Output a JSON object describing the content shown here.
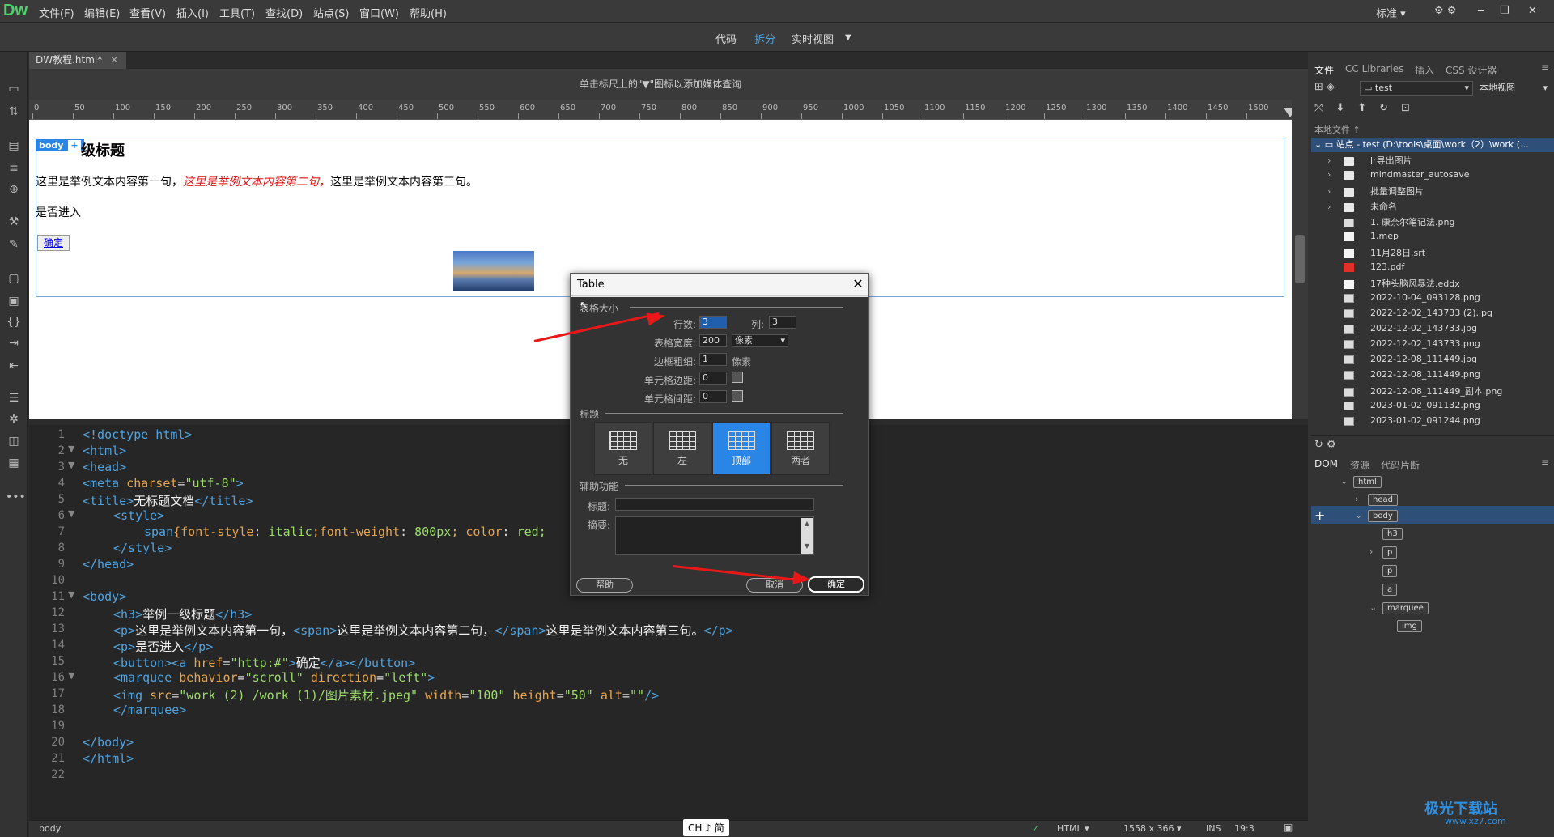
{
  "app": {
    "logo": "Dw",
    "workspace": "标准"
  },
  "menu": [
    "文件(F)",
    "编辑(E)",
    "查看(V)",
    "插入(I)",
    "工具(T)",
    "查找(D)",
    "站点(S)",
    "窗口(W)",
    "帮助(H)"
  ],
  "views": {
    "code": "代码",
    "split": "拆分",
    "live": "实时视图"
  },
  "document": {
    "tab": "DW教程.html*",
    "hint": "单击标尺上的\"▼\"图标以添加媒体查询"
  },
  "ruler": [
    "0",
    "50",
    "100",
    "150",
    "200",
    "250",
    "300",
    "350",
    "400",
    "450",
    "500",
    "550",
    "600",
    "650",
    "700",
    "750",
    "800",
    "850",
    "900",
    "950",
    "1000",
    "1050",
    "1100",
    "1150",
    "1200",
    "1250",
    "1300",
    "1350",
    "1400",
    "1450",
    "1500"
  ],
  "live": {
    "body_tag": "body",
    "plus": "+",
    "h3": "级标题",
    "p1a": "这里是举例文本内容第一句，",
    "p1b": "这里是举例文本内容第二句，",
    "p1c": "这里是举例文本内容第三句。",
    "p2": "是否进入",
    "button": "确定"
  },
  "code": {
    "lines": [
      "1",
      "2",
      "3",
      "4",
      "5",
      "6",
      "7",
      "8",
      "9",
      "10",
      "11",
      "12",
      "13",
      "14",
      "15",
      "16",
      "17",
      "18",
      "19",
      "20",
      "21",
      "22"
    ],
    "l1": "<!doctype html>",
    "l2": "<html>",
    "l3": "<head>",
    "l4a": "<meta ",
    "l4b": "charset",
    "l4c": "=",
    "l4d": "\"utf-8\"",
    "l4e": ">",
    "l5a": "<title>",
    "l5b": "无标题文档",
    "l5c": "</title>",
    "l6": "<style>",
    "l7a": "span",
    "l7b": "{font-style",
    "l7c": ": ",
    "l7d": "italic",
    "l7e": ";font-weight",
    "l7f": ": ",
    "l7g": "800px",
    "l7h": "; color",
    "l7i": ": ",
    "l7j": "red;",
    "l8": "</style>",
    "l9": "</head>",
    "l11": "<body>",
    "l12a": "<h3>",
    "l12b": "举例一级标题",
    "l12c": "</h3>",
    "l13a": "<p>",
    "l13b": "这里是举例文本内容第一句，",
    "l13c": "<span>",
    "l13d": "这里是举例文本内容第二句，",
    "l13e": "</span>",
    "l13f": "这里是举例文本内容第三句。",
    "l13g": "</p>",
    "l14a": "<p>",
    "l14b": "是否进入",
    "l14c": "</p>",
    "l15a": "<button><a ",
    "l15b": "href",
    "l15c": "=",
    "l15d": "\"http:#\"",
    "l15e": ">",
    "l15f": "确定",
    "l15g": "</a></button>",
    "l16a": "<marquee ",
    "l16b": "behavior",
    "l16c": "=",
    "l16d": "\"scroll\"",
    "l16e": " direction",
    "l16f": "=",
    "l16g": "\"left\"",
    "l16h": ">",
    "l17a": "<img ",
    "l17b": "src",
    "l17c": "=",
    "l17d": "\"work (2) /work (1)/图片素材.jpeg\"",
    "l17e": " width",
    "l17f": "=",
    "l17g": "\"100\"",
    "l17h": " height",
    "l17i": "=",
    "l17j": "\"50\"",
    "l17k": " alt",
    "l17l": "=",
    "l17m": "\"\"",
    "l17n": "/>",
    "l18": "</marquee>",
    "l20": "</body>",
    "l21": "</html>"
  },
  "status": {
    "tag": "body",
    "ime": "CH ♪ 简",
    "lang": "HTML",
    "size": "1558 x 366",
    "mode": "INS",
    "pos": "19:3"
  },
  "files_panel": {
    "tabs": [
      "文件",
      "CC Libraries",
      "插入",
      "CSS 设计器"
    ],
    "site": "test",
    "view": "本地视图",
    "local_label": "本地文件 ↑",
    "site_row": "站点 - test (D:\\tools\\桌面\\work（2）\\work (...",
    "items": [
      {
        "name": "lr导出图片",
        "type": "folder"
      },
      {
        "name": "mindmaster_autosave",
        "type": "folder"
      },
      {
        "name": "批量调整图片",
        "type": "folder"
      },
      {
        "name": "未命名",
        "type": "folder"
      },
      {
        "name": "1. 康奈尔笔记法.png",
        "type": "img"
      },
      {
        "name": "1.mep",
        "type": "file"
      },
      {
        "name": "11月28日.srt",
        "type": "file"
      },
      {
        "name": "123.pdf",
        "type": "pdf"
      },
      {
        "name": "17种头脑风暴法.eddx",
        "type": "file"
      },
      {
        "name": "2022-10-04_093128.png",
        "type": "img"
      },
      {
        "name": "2022-12-02_143733 (2).jpg",
        "type": "img"
      },
      {
        "name": "2022-12-02_143733.jpg",
        "type": "img"
      },
      {
        "name": "2022-12-02_143733.png",
        "type": "img"
      },
      {
        "name": "2022-12-08_111449.jpg",
        "type": "img"
      },
      {
        "name": "2022-12-08_111449.png",
        "type": "img"
      },
      {
        "name": "2022-12-08_111449_副本.png",
        "type": "img"
      },
      {
        "name": "2023-01-02_091132.png",
        "type": "img"
      },
      {
        "name": "2023-01-02_091244.png",
        "type": "img"
      }
    ]
  },
  "dom_panel": {
    "tabs": [
      "DOM",
      "资源",
      "代码片断"
    ],
    "nodes": [
      "html",
      "head",
      "body",
      "h3",
      "p",
      "p",
      "a",
      "marquee",
      "img"
    ]
  },
  "dialog": {
    "title": "Table",
    "sec_size": "表格大小",
    "rows_label": "行数:",
    "rows": "3",
    "cols_label": "列:",
    "cols": "3",
    "width_label": "表格宽度:",
    "width": "200",
    "width_unit": "像素",
    "border_label": "边框粗细:",
    "border": "1",
    "border_unit": "像素",
    "padding_label": "单元格边距:",
    "padding": "0",
    "spacing_label": "单元格间距:",
    "spacing": "0",
    "sec_header": "标题",
    "header_opts": [
      "无",
      "左",
      "顶部",
      "两者"
    ],
    "sec_access": "辅助功能",
    "caption_label": "标题:",
    "summary_label": "摘要:",
    "help": "帮助",
    "cancel": "取消",
    "ok": "确定"
  },
  "watermark": {
    "brand": "极光下载站",
    "url": "www.xz7.com"
  },
  "colors": {
    "accent": "#2a86e6",
    "arrow": "#e81818",
    "logo": "#4fd16e"
  }
}
